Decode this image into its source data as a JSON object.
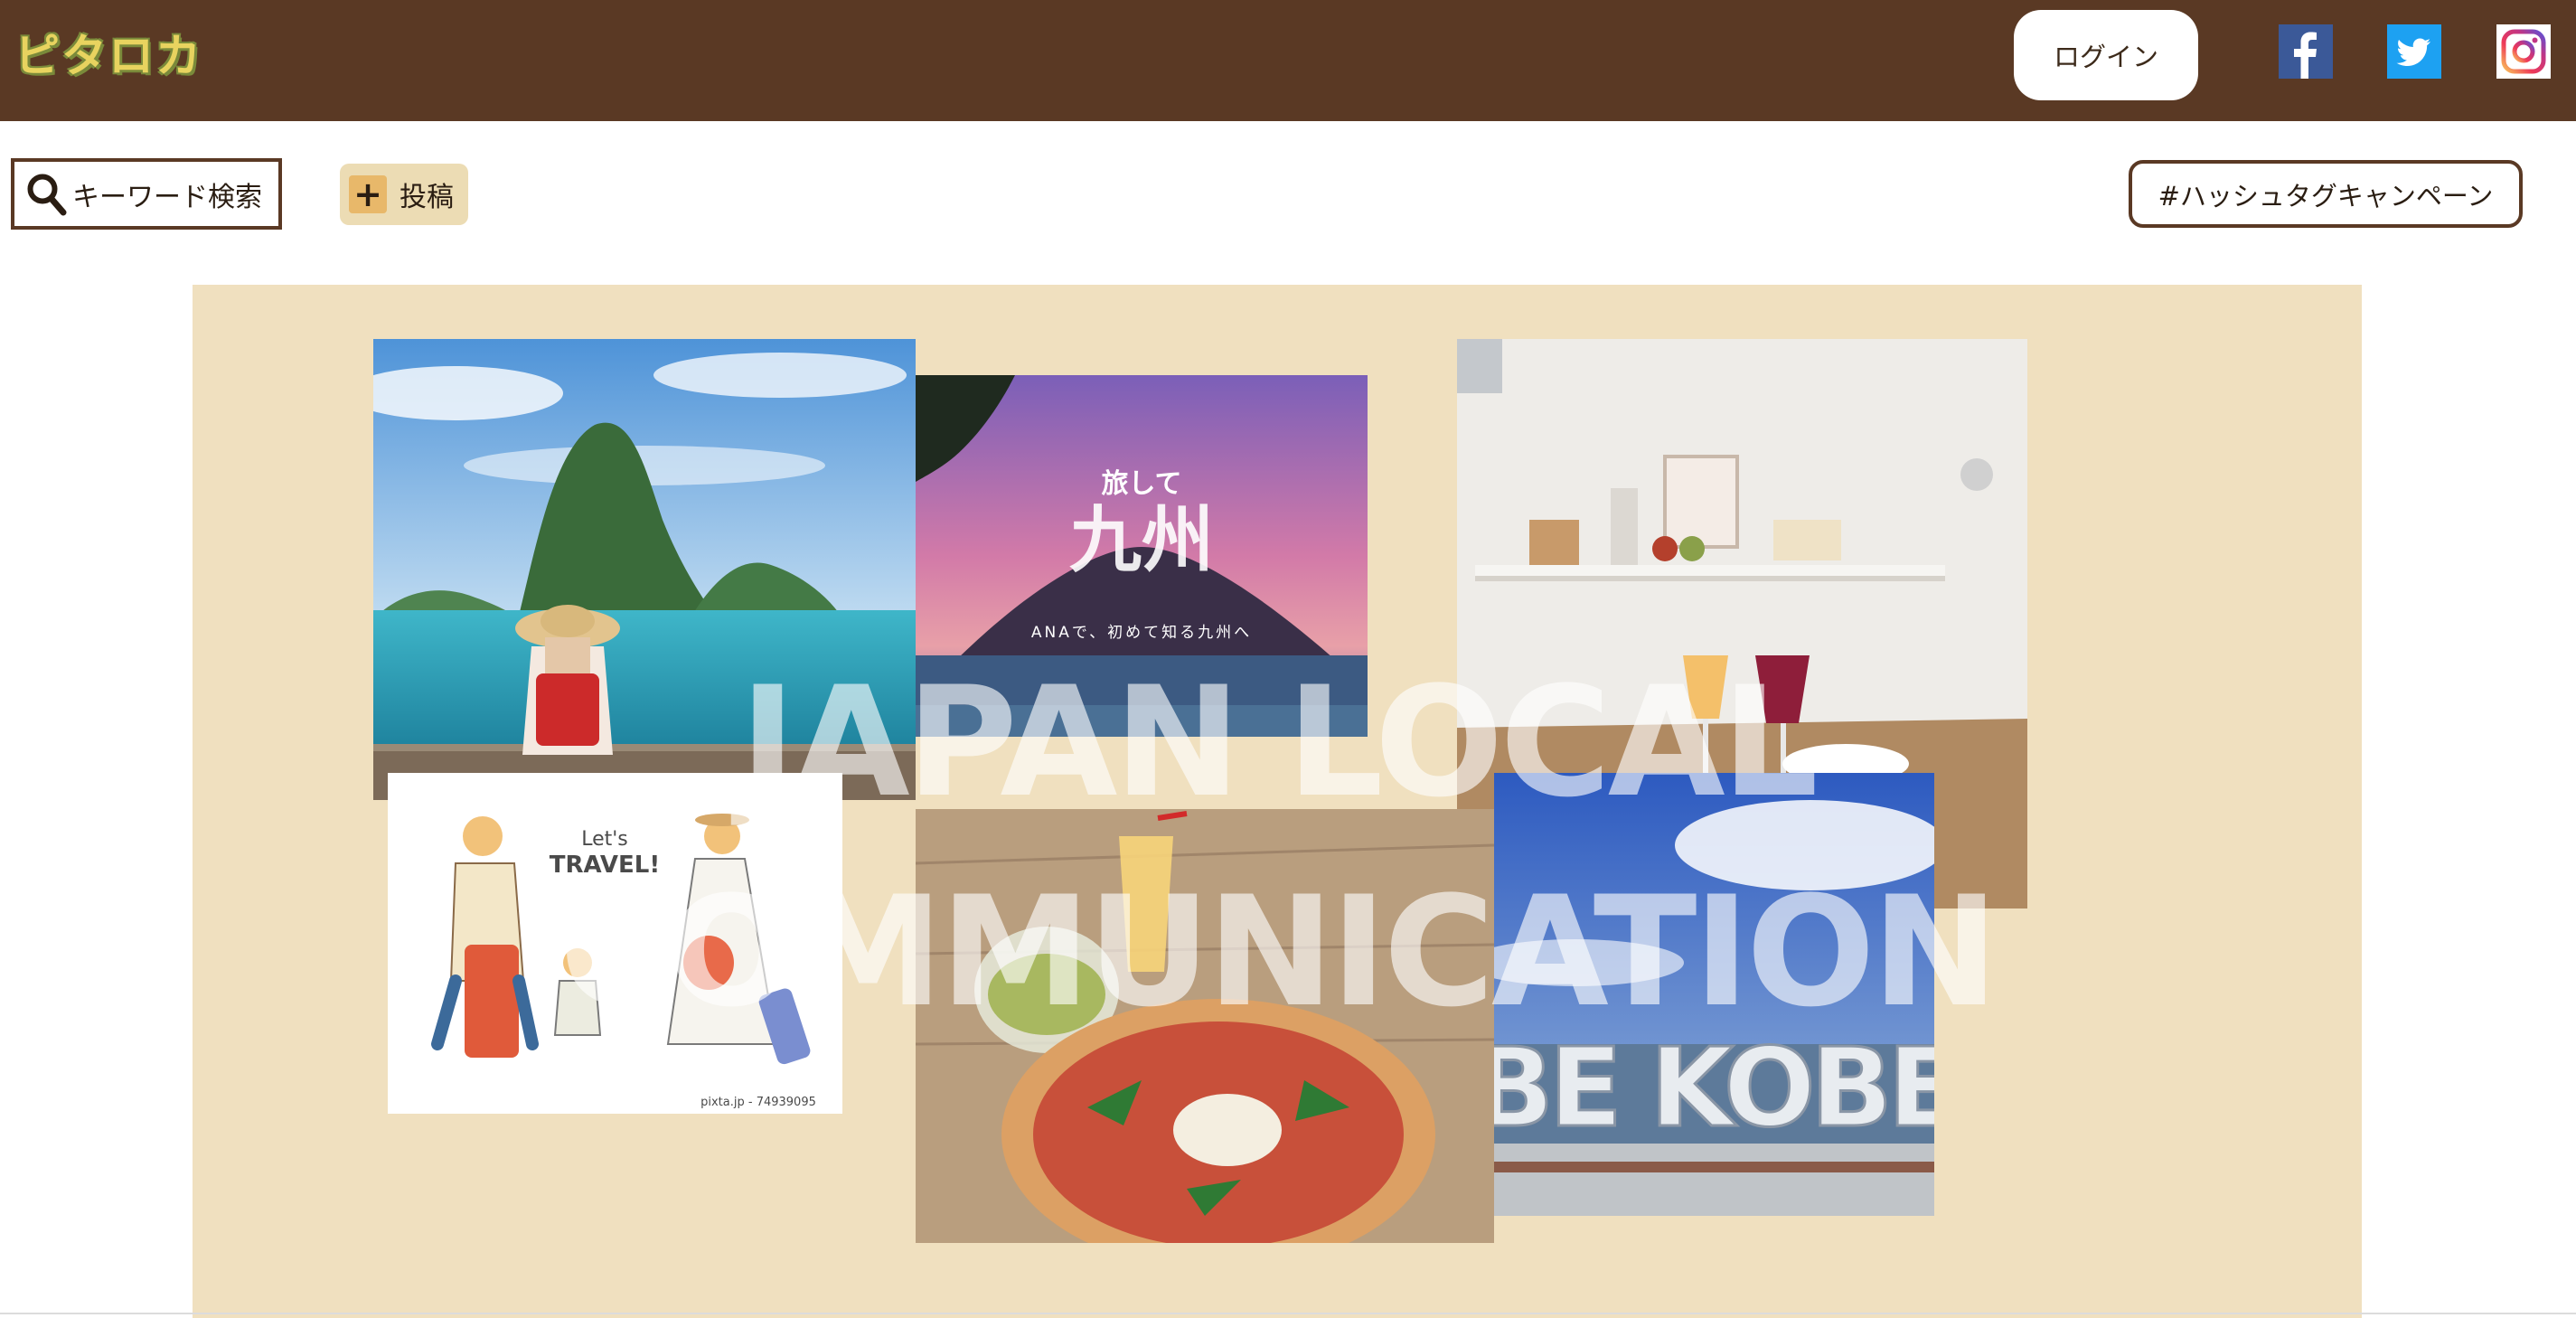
{
  "header": {
    "logo": "ピタロカ",
    "login_label": "ログイン",
    "social": [
      "facebook-icon",
      "twitter-icon",
      "instagram-icon"
    ]
  },
  "toolbar": {
    "search_label": "キーワード検索",
    "post_label": "投稿",
    "hashtag_label": "#ハッシュタグキャンペーン"
  },
  "hero": {
    "overlay_line1": "JAPAN LOCAL",
    "overlay_line2": "COMMUNICATION",
    "photos": {
      "kyushu_title": "旅して",
      "kyushu_big": "九州",
      "kyushu_sub": "ANAで、初めて知る九州へ",
      "travel_title": "Let's",
      "travel_title2": "TRAVEL!",
      "travel_credit": "pixta.jp - 74939095",
      "kobe_sign": "BE KOBE"
    }
  },
  "colors": {
    "header_bg": "#5a3924",
    "hero_bg": "#f0e0bf",
    "post_btn_bg": "#ecdcb4"
  }
}
